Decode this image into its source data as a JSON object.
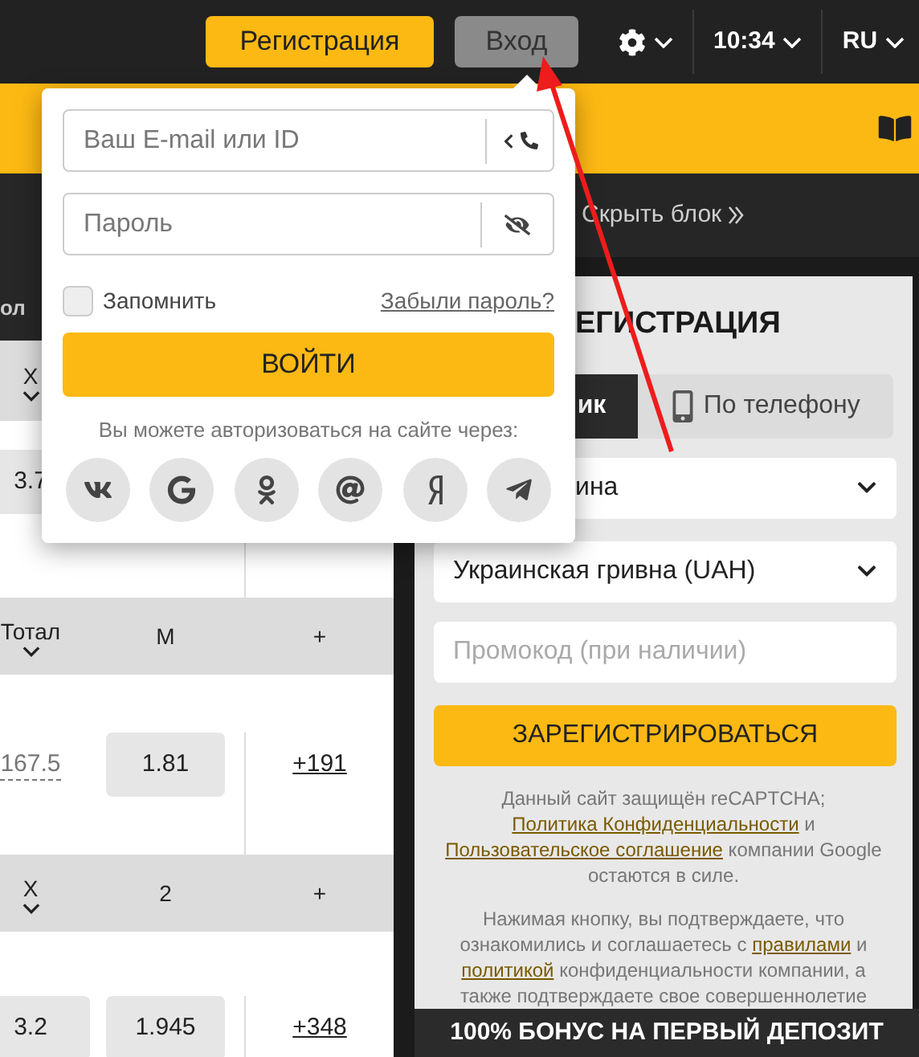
{
  "top_bar": {
    "register_button": "Регистрация",
    "login_button": {
      "label": "Вход",
      "selected": true
    },
    "time": "10:34",
    "language": "RU"
  },
  "table": {
    "header_strip": "ол",
    "sections": [
      {
        "headers": [
          {
            "label": "X",
            "dropdown": true
          }
        ],
        "cells": [
          {
            "kind": "odds",
            "text": "3.7"
          }
        ]
      },
      {
        "headers": [
          {
            "label": "Тотал",
            "dropdown": true
          },
          {
            "label": "M",
            "dropdown": false
          },
          {
            "label": "+",
            "dropdown": false
          }
        ],
        "cells": [
          {
            "kind": "line",
            "text": "167.5"
          },
          {
            "kind": "odds",
            "text": "1.81"
          },
          {
            "kind": "more",
            "text": "+191"
          }
        ]
      },
      {
        "headers": [
          {
            "label": "X",
            "dropdown": true
          },
          {
            "label": "2",
            "dropdown": false
          },
          {
            "label": "+",
            "dropdown": false
          }
        ],
        "cells": [
          {
            "kind": "odds",
            "text": "3.2"
          },
          {
            "kind": "odds",
            "text": "1.945"
          },
          {
            "kind": "more",
            "text": "+348"
          }
        ]
      }
    ]
  },
  "side_panel": {
    "hide_link": "Скрыть блок",
    "title": "ЕГИСТРАЦИЯ",
    "tabs": [
      {
        "label": "ик",
        "selected": true,
        "kind": "text"
      },
      {
        "label": "По телефону",
        "selected": false,
        "kind": "phone"
      }
    ],
    "selects": [
      "ина",
      "Украинская гривна (UAH)"
    ],
    "promo_placeholder": "Промокод (при наличии)",
    "submit_button": "ЗАРЕГИСТРИРОВАТЬСЯ",
    "notes": [
      [
        {
          "text": "Данный сайт защищён reCAPTCHA; ",
          "link": false
        },
        {
          "text": "Политика Конфиденциальности",
          "link": true
        },
        {
          "text": " и ",
          "link": false
        },
        {
          "text": "Пользовательское соглашение",
          "link": true
        },
        {
          "text": " компании Google остаются в силе.",
          "link": false
        }
      ],
      [
        {
          "text": "Нажимая кнопку, вы подтверждаете, что ознакомились и соглашаетесь с ",
          "link": false
        },
        {
          "text": "правилами",
          "link": true
        },
        {
          "text": " и ",
          "link": false
        },
        {
          "text": "политикой",
          "link": true
        },
        {
          "text": " конфиденциальности компании, а также подтверждаете свое совершеннолетие",
          "link": false
        }
      ]
    ],
    "bonus_banner": "100% БОНУС НА ПЕРВЫЙ ДЕПОЗИТ"
  },
  "login_popup": {
    "email_placeholder": "Ваш E-mail или ID",
    "password_placeholder": "Пароль",
    "remember": {
      "label": "Запомнить",
      "checked": false
    },
    "forgot_link": "Забыли пароль?",
    "submit_button": "ВОЙТИ",
    "social_caption": "Вы можете авторизоваться на сайте через:",
    "social": [
      {
        "kind": "vk"
      },
      {
        "kind": "g"
      },
      {
        "kind": "ok"
      },
      {
        "kind": "at"
      },
      {
        "kind": "ya"
      },
      {
        "kind": "plane"
      }
    ]
  }
}
